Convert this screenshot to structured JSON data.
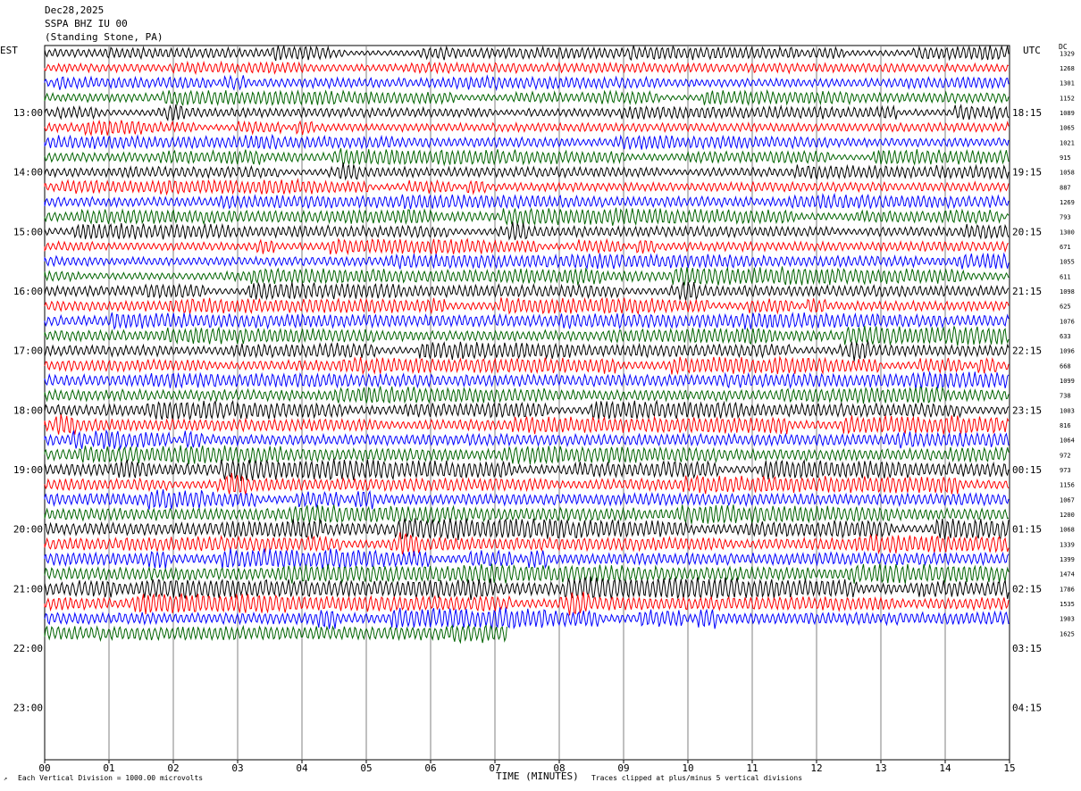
{
  "header": {
    "date": "Dec28,2025",
    "station": "SSPA BHZ IU 00",
    "location": "(Standing Stone, PA)"
  },
  "axis": {
    "left_tz": "EST",
    "right_tz": "UTC",
    "dc_label": "DC",
    "xlabel": "TIME (MINUTES)"
  },
  "footer": {
    "scale_note": "Each Vertical Division = 1000.00 microvolts",
    "clip_note": "Traces clipped at plus/minus 5 vertical divisions"
  },
  "colors": {
    "trace_cycle": [
      "#000000",
      "#ff0000",
      "#0000ff",
      "#006400"
    ],
    "grid": "#808080"
  },
  "chart_data": {
    "type": "line",
    "title": "SSPA BHZ IU 00",
    "xlabel": "TIME (MINUTES)",
    "xlim": [
      0,
      15
    ],
    "x_ticks": [
      "00",
      "01",
      "02",
      "03",
      "04",
      "05",
      "06",
      "07",
      "08",
      "09",
      "10",
      "11",
      "12",
      "13",
      "14",
      "15"
    ],
    "rows_total": 48,
    "rows_with_data": 40,
    "last_row_minutes": 7.2,
    "est_hour_labels": [
      "13:00",
      "14:00",
      "15:00",
      "16:00",
      "17:00",
      "18:00",
      "19:00",
      "20:00",
      "21:00",
      "22:00",
      "23:00"
    ],
    "utc_hour_labels": [
      "18:15",
      "19:15",
      "20:15",
      "21:15",
      "22:15",
      "23:15",
      "00:15",
      "01:15",
      "02:15",
      "03:15",
      "04:15"
    ],
    "dc_offsets": [
      "1329",
      "1268",
      "1301",
      "1152",
      "1089",
      "1065",
      "1021",
      "915",
      "1058",
      "887",
      "1269",
      "793",
      "1300",
      "671",
      "1055",
      "611",
      "1098",
      "625",
      "1076",
      "633",
      "1096",
      "668",
      "1099",
      "738",
      "1003",
      "816",
      "1064",
      "972",
      "973",
      "1156",
      "1067",
      "1200",
      "1068",
      "1339",
      "1399",
      "1474",
      "1786",
      "1535",
      "1903",
      "1625"
    ]
  }
}
